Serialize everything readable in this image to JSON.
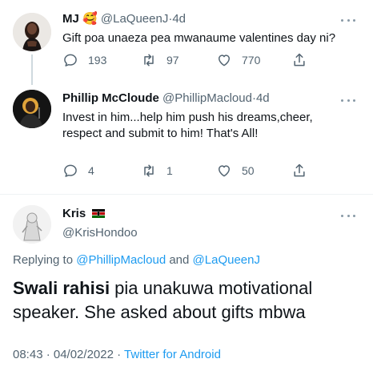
{
  "tweets": [
    {
      "name": "MJ",
      "emoji": "🥰",
      "handle": "@LaQueenJ",
      "separator": "·",
      "time": "4d",
      "text": "Gift poa unaeza pea mwanaume valentines day ni?",
      "replies": "193",
      "retweets": "97",
      "likes": "770"
    },
    {
      "name": "Phillip McCloude",
      "handle": "@PhillipMacloud",
      "separator": "·",
      "time": "4d",
      "text": "Invest in him...help him push his dreams,cheer, respect and submit to him! That's All!",
      "replies": "4",
      "retweets": "1",
      "likes": "50"
    }
  ],
  "main_tweet": {
    "name": "Kris",
    "handle": "@KrisHondoo",
    "replying_prefix": "Replying to",
    "replying_user1": "@PhillipMacloud",
    "replying_and": "and",
    "replying_user2": "@LaQueenJ",
    "text_bold": "Swali rahisi",
    "text_rest": " pia unakuwa motivational speaker. She asked about gifts mbwa",
    "timestamp": "08:43 · 04/02/2022",
    "separator": "·",
    "source": "Twitter for Android",
    "source_color": "#1d9bf0"
  },
  "colors": {
    "link": "#1d9bf0",
    "secondary": "#536471"
  }
}
